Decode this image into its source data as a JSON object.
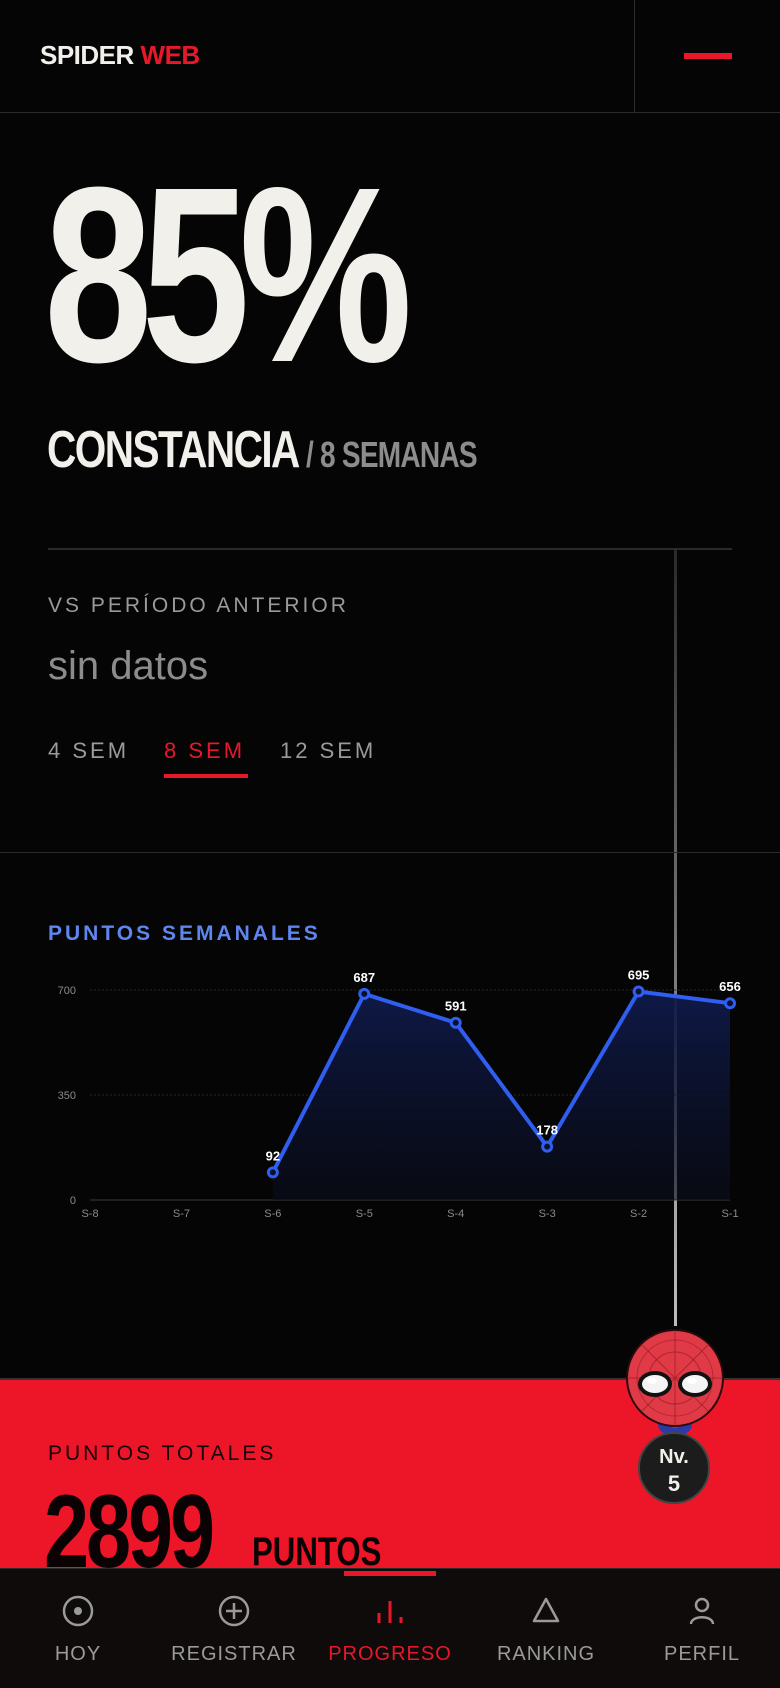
{
  "header": {
    "logo_part1": "SPIDER",
    "logo_part2": "WEB",
    "menu_icon": "hamburger-icon"
  },
  "hero": {
    "percentage": "85%",
    "label": "CONSTANCIA",
    "period": "/ 8 SEMANAS"
  },
  "comparison": {
    "label": "VS PERÍODO ANTERIOR",
    "value": "sin datos"
  },
  "period_tabs": [
    {
      "label": "4 SEM",
      "active": false
    },
    {
      "label": "8 SEM",
      "active": true
    },
    {
      "label": "12 SEM",
      "active": false
    }
  ],
  "chart_section": {
    "title": "PUNTOS SEMANALES"
  },
  "chart_data": {
    "type": "area",
    "title": "PUNTOS SEMANALES",
    "categories": [
      "S-8",
      "S-7",
      "S-6",
      "S-5",
      "S-4",
      "S-3",
      "S-2",
      "S-1"
    ],
    "series": [
      {
        "values": [
          null,
          null,
          92,
          687,
          591,
          178,
          695,
          656
        ]
      }
    ],
    "yticks": [
      "0",
      "350",
      "700"
    ],
    "ylim": [
      0,
      700
    ],
    "grid": true,
    "colors": {
      "line": "#2f5ef0",
      "fill": "#0f1a4a",
      "label": "#ffffff"
    }
  },
  "totals": {
    "label": "PUNTOS TOTALES",
    "value": "2899",
    "unit": "PUNTOS"
  },
  "level": {
    "prefix": "Nv.",
    "number": "5"
  },
  "nav": [
    {
      "label": "HOY",
      "icon": "target-icon",
      "active": false
    },
    {
      "label": "REGISTRAR",
      "icon": "plus-circle-icon",
      "active": false
    },
    {
      "label": "PROGRESO",
      "icon": "bar-chart-icon",
      "active": true
    },
    {
      "label": "RANKING",
      "icon": "triangle-icon",
      "active": false
    },
    {
      "label": "PERFIL",
      "icon": "user-icon",
      "active": false
    }
  ],
  "colors": {
    "accent": "#e8182a",
    "background": "#050505",
    "chart_blue": "#2f5ef0",
    "chart_title": "#5e86ee"
  }
}
